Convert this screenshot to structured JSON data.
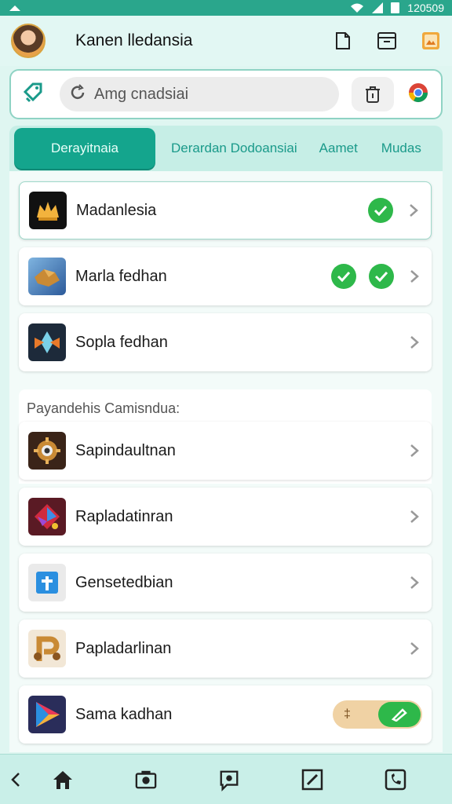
{
  "status_bar": {
    "time": "120509"
  },
  "header": {
    "user_name": "Kanen lledansia"
  },
  "search": {
    "placeholder": "Amg cnadsiai"
  },
  "tabs": [
    {
      "label": "Derayitnaia"
    },
    {
      "label": "Derardan Dodoansiai"
    },
    {
      "label": "Aamet"
    },
    {
      "label": "Mudas"
    }
  ],
  "apps_top": [
    {
      "label": "Madanlesia",
      "checks": 1,
      "icon": "crown-app-icon"
    },
    {
      "label": "Marla fedhan",
      "checks": 2,
      "icon": "puzzle-app-icon"
    },
    {
      "label": "Sopla fedhan",
      "checks": 0,
      "icon": "eagle-app-icon"
    }
  ],
  "section": {
    "title": "Payandehis Camisndua:"
  },
  "apps_bottom": [
    {
      "label": "Sapindaultnan",
      "icon": "gear-app-icon"
    },
    {
      "label": "Rapladatinran",
      "icon": "star-app-icon"
    },
    {
      "label": "Gensetedbian",
      "icon": "plus-app-icon"
    },
    {
      "label": "Papladarlinan",
      "icon": "p-app-icon"
    },
    {
      "label": "Sama kadhan",
      "icon": "play-app-icon",
      "toggle": true
    }
  ],
  "toggle": {
    "off_label": "‡"
  },
  "colors": {
    "accent": "#14a58d",
    "background": "#dff6f1",
    "check": "#2eb84a"
  }
}
